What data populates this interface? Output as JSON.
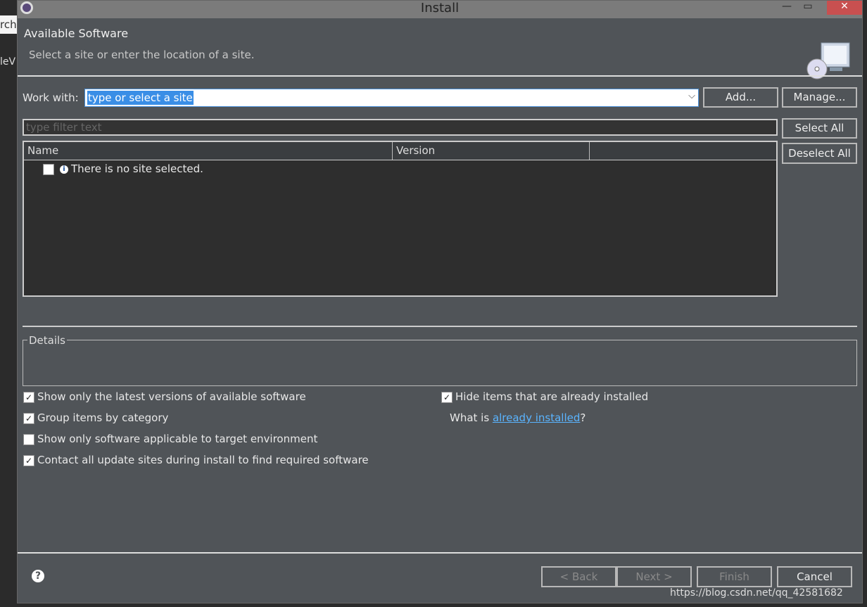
{
  "window": {
    "title": "Install",
    "close_glyph": "✕",
    "minimize_glyph": "—",
    "maximize_glyph": "▭"
  },
  "background": {
    "snippet1": "rch",
    "snippet2": "leV"
  },
  "header": {
    "title": "Available Software",
    "subtitle": "Select a site or enter the location of a site."
  },
  "work_with": {
    "label": "Work with:",
    "value": "type or select a site",
    "add": "Add...",
    "manage": "Manage..."
  },
  "filter": {
    "placeholder": "type filter text"
  },
  "side_buttons": {
    "select_all": "Select All",
    "deselect_all": "Deselect All"
  },
  "table": {
    "columns": [
      "Name",
      "Version",
      ""
    ],
    "rows": [
      {
        "checked": false,
        "text": "There is no site selected."
      }
    ]
  },
  "details": {
    "label": "Details"
  },
  "options": [
    {
      "label": "Show only the latest versions of available software",
      "checked": true
    },
    {
      "label": "Group items by category",
      "checked": true
    },
    {
      "label": "Show only software applicable to target environment",
      "checked": false
    },
    {
      "label": "Contact all update sites during install to find required software",
      "checked": true
    },
    {
      "label": "Hide items that are already installed",
      "checked": true
    }
  ],
  "installed": {
    "prefix": "What is ",
    "link": "already installed",
    "suffix": "?"
  },
  "footer": {
    "back": "< Back",
    "next": "Next >",
    "finish": "Finish",
    "cancel": "Cancel"
  },
  "watermark": "https://blog.csdn.net/qq_42581682"
}
